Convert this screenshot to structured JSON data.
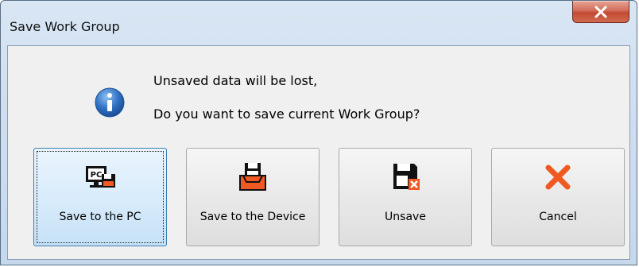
{
  "window": {
    "title": "Save Work Group",
    "close_glyph": "X"
  },
  "message": {
    "line1": "Unsaved data will be lost,",
    "line2": "Do you want to save current Work Group?",
    "icon": "info-icon"
  },
  "buttons": [
    {
      "label": "Save to the PC",
      "icon": "pc-save-icon",
      "default": true
    },
    {
      "label": "Save to the Device",
      "icon": "device-save-icon",
      "default": false
    },
    {
      "label": "Unsave",
      "icon": "unsave-icon",
      "default": false
    },
    {
      "label": "Cancel",
      "icon": "cancel-x-icon",
      "default": false
    }
  ],
  "colors": {
    "accent_orange": "#f05a22",
    "info_blue": "#2f6fc2"
  }
}
